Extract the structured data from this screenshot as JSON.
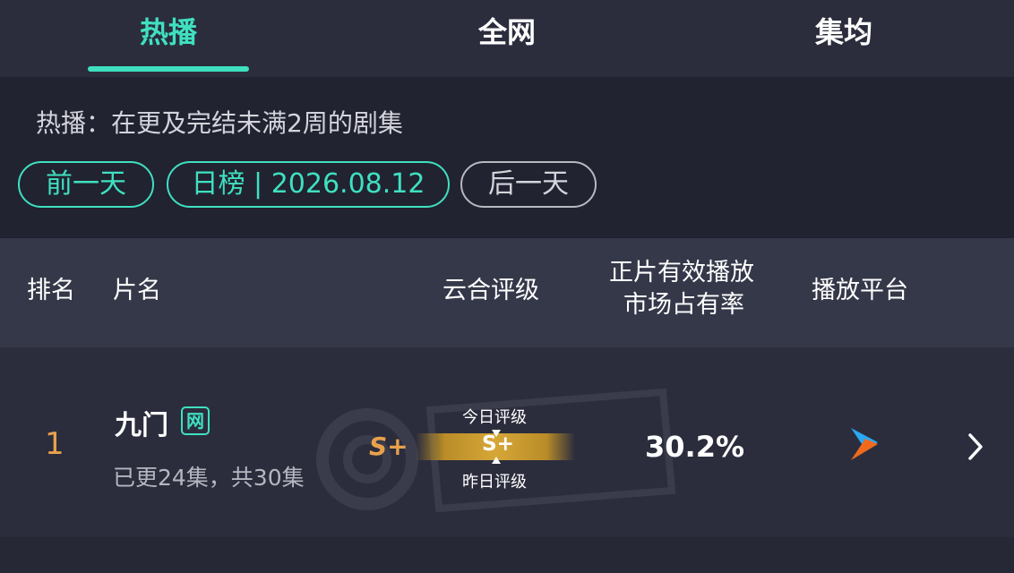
{
  "tabs": [
    {
      "label": "热播",
      "active": true
    },
    {
      "label": "全网",
      "active": false
    },
    {
      "label": "集均",
      "active": false
    }
  ],
  "filter": {
    "description": "热播：在更及完结未满2周的剧集",
    "prev_day": "前一天",
    "date_label": "日榜 | 2026.08.12",
    "next_day": "后一天"
  },
  "table_header": {
    "rank": "排名",
    "title": "片名",
    "rating": "云合评级",
    "share_line1": "正片有效播放",
    "share_line2": "市场占有率",
    "platform": "播放平台"
  },
  "rows": [
    {
      "rank": "1",
      "title": "九门",
      "badge": "网",
      "episodes": "已更24集，共30集",
      "rating_today_label": "今日评级",
      "rating_today": "S+",
      "rating_yesterday_label": "昨日评级",
      "rating_yesterday": "S+",
      "share": "30.2%",
      "platform_icon": "youku-play-icon"
    }
  ],
  "colors": {
    "accent": "#3fe0c0",
    "rank": "#e8a14c",
    "background": "#2b2d3d"
  }
}
